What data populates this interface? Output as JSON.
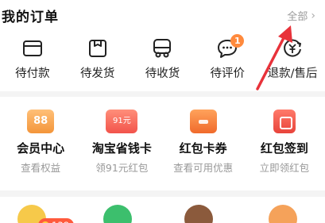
{
  "orders": {
    "title": "我的订单",
    "all_label": "全部",
    "items": [
      {
        "label": "待付款",
        "icon": "wallet-icon"
      },
      {
        "label": "待发货",
        "icon": "package-icon"
      },
      {
        "label": "待收货",
        "icon": "truck-icon"
      },
      {
        "label": "待评价",
        "icon": "comment-icon",
        "badge": "1"
      },
      {
        "label": "退款/售后",
        "icon": "refund-icon"
      }
    ]
  },
  "services": {
    "items": [
      {
        "name": "会员中心",
        "sub": "查看权益",
        "icon_text": "88"
      },
      {
        "name": "淘宝省钱卡",
        "sub": "领91元红包",
        "icon_text": "91元"
      },
      {
        "name": "红包卡券",
        "sub": "查看可用优惠"
      },
      {
        "name": "红包签到",
        "sub": "立即领红包"
      }
    ]
  },
  "bottom": {
    "coin_badge": "138"
  },
  "colors": {
    "accent": "#ff8a3d",
    "badge": "#ff5a3c",
    "arrow": "#e8323a"
  }
}
